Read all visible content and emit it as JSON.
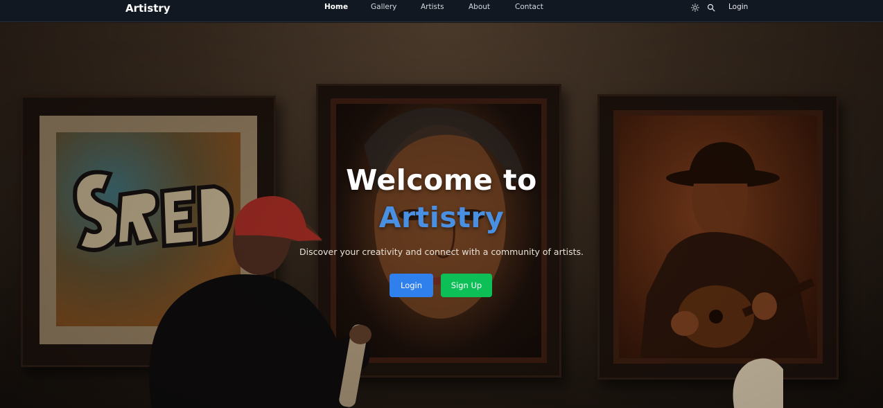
{
  "brand": "Artistry",
  "nav": {
    "links": [
      {
        "label": "Home",
        "active": true
      },
      {
        "label": "Gallery",
        "active": false
      },
      {
        "label": "Artists",
        "active": false
      },
      {
        "label": "About",
        "active": false
      },
      {
        "label": "Contact",
        "active": false
      }
    ],
    "icons": [
      "sun-icon",
      "search-icon"
    ],
    "login_label": "Login"
  },
  "hero": {
    "title_line1": "Welcome to",
    "title_line2": "Artistry",
    "subtitle": "Discover your creativity and connect with a community of artists.",
    "login_button": "Login",
    "signup_button": "Sign Up"
  },
  "colors": {
    "nav_bg": "#111821",
    "accent_blue": "#2f80ed",
    "title_blue": "#4a90e2",
    "signup_green": "#0cc057"
  }
}
